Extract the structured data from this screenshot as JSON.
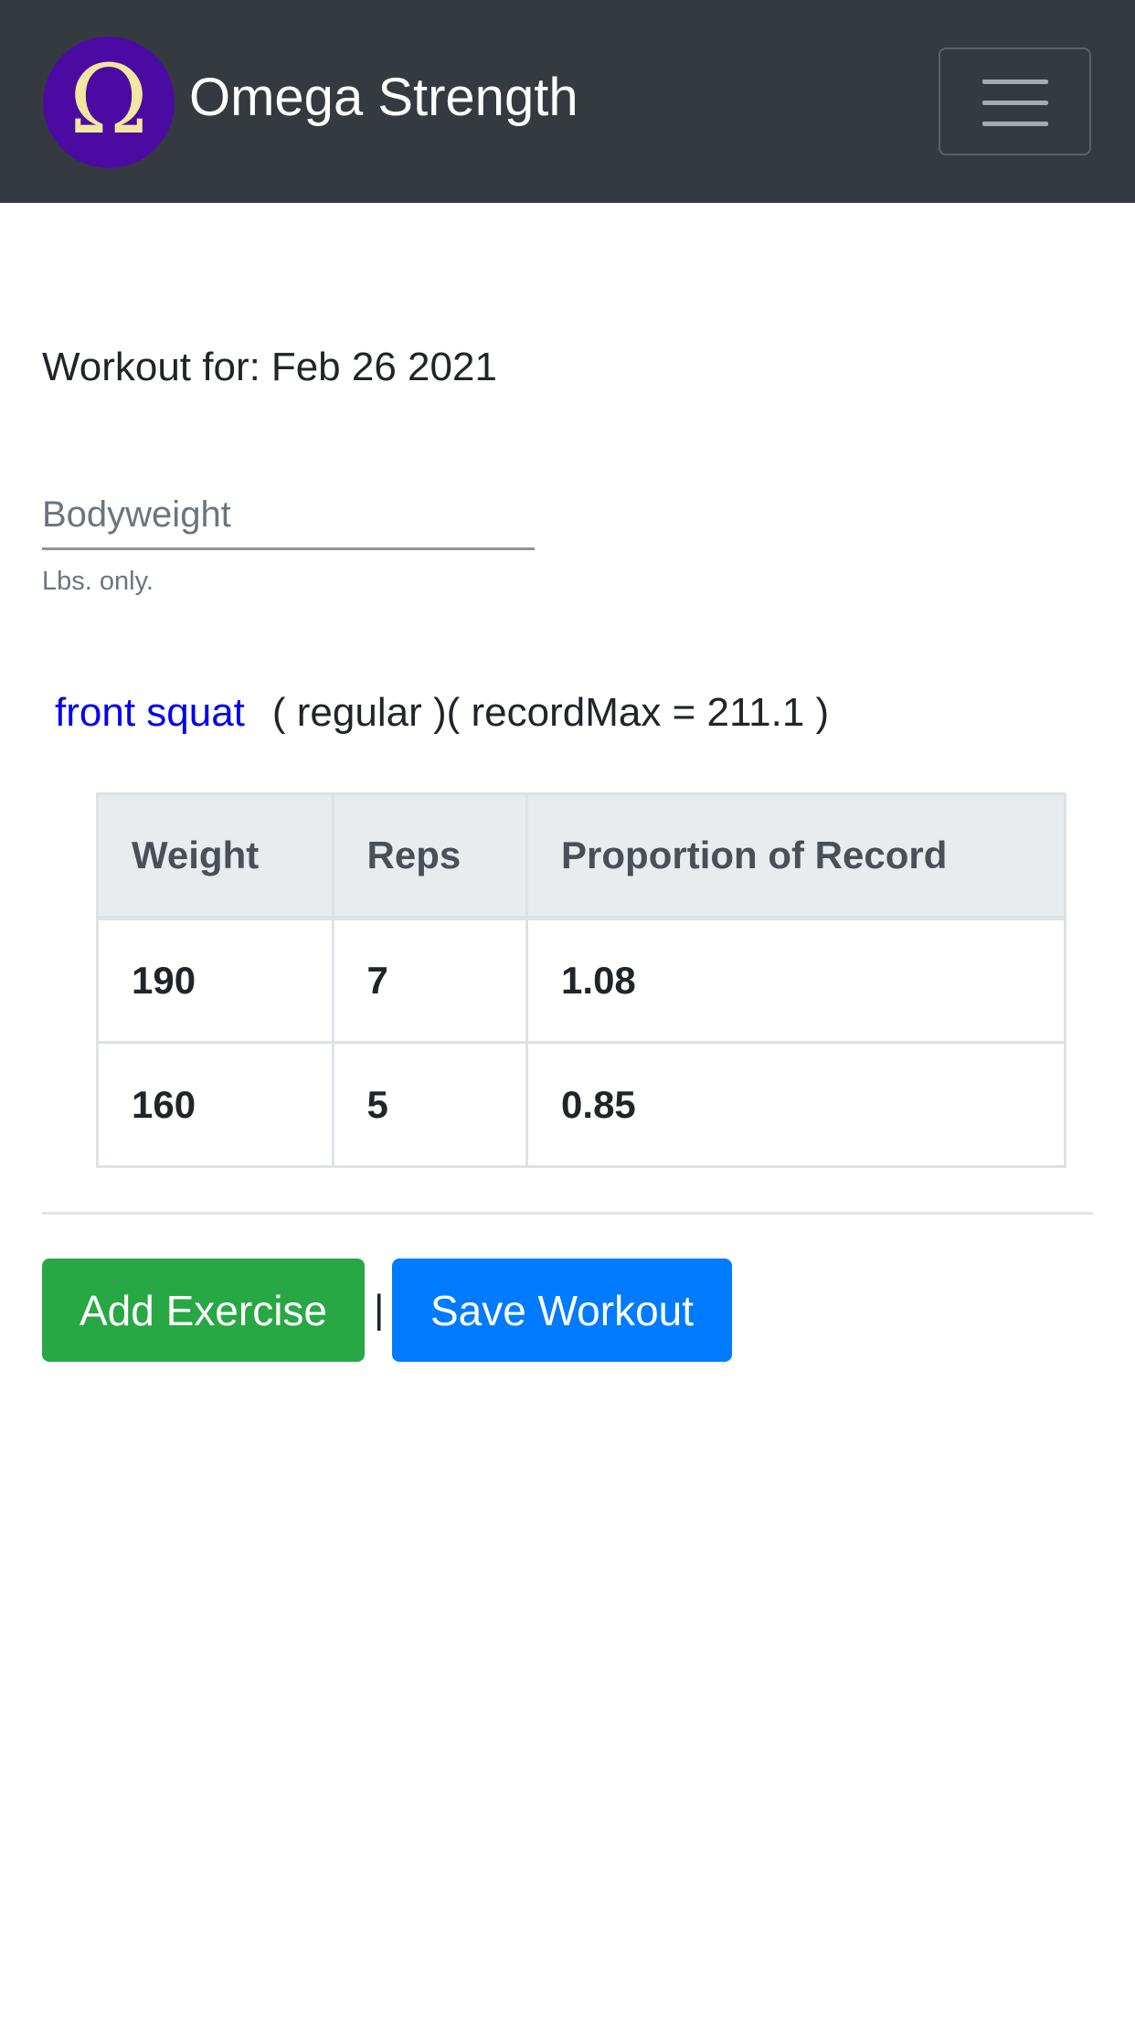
{
  "navbar": {
    "logo_glyph": "Ω",
    "brand_name": "Omega Strength",
    "toggler_icon": "hamburger-menu-icon",
    "colors": {
      "background": "#343a40",
      "logo_bg": "#4b0ba3",
      "logo_glyph": "#f2e6a0"
    }
  },
  "workout": {
    "date_label": "Workout for:",
    "date_value": "Feb 26 2021"
  },
  "bodyweight": {
    "placeholder": "Bodyweight",
    "value": "",
    "help_text": "Lbs. only."
  },
  "exercise": {
    "name": "front squat",
    "meta": "( regular )( recordMax = 211.1 )",
    "table": {
      "headers": [
        "Weight",
        "Reps",
        "Proportion of Record"
      ],
      "rows": [
        [
          "190",
          "7",
          "1.08"
        ],
        [
          "160",
          "5",
          "0.85"
        ]
      ]
    }
  },
  "actions": {
    "add_label": "Add Exercise",
    "separator": "|",
    "save_label": "Save Workout",
    "colors": {
      "add": "#28a745",
      "save": "#007bff"
    }
  }
}
